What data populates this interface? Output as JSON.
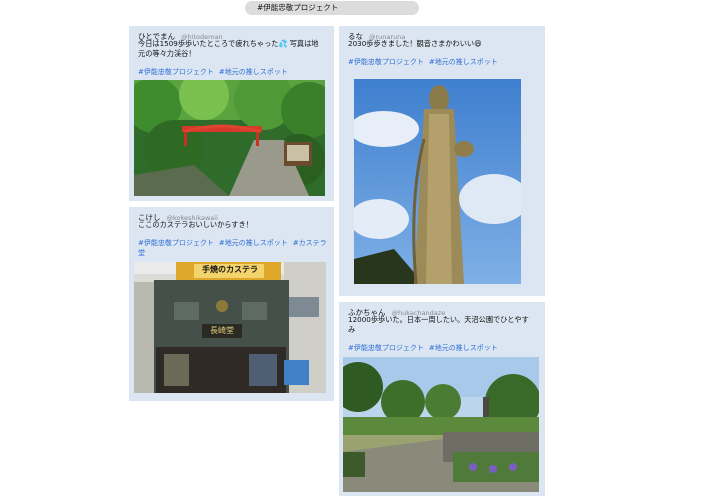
{
  "search_tag": "#伊能忠敬プロジェクト",
  "posts": [
    {
      "name": "ひとでまん",
      "handle": "@hitodeman",
      "message_line1": "今日は1509歩歩いたところで疲れちゃった💦 写真は地",
      "message_line2": "元の等々力渓谷！",
      "tags": [
        "#伊能忠敬プロジェクト",
        "#地元の推しスポット"
      ],
      "image_icon": "gorge-bridge-photo"
    },
    {
      "name": "るな",
      "handle": "@runaruna",
      "message_line1": "2030歩歩きました！観音さまかわいい😄",
      "tags": [
        "#伊能忠敬プロジェクト",
        "#地元の推しスポット"
      ],
      "image_icon": "kannon-statue-photo"
    },
    {
      "name": "こけし",
      "handle": "@kokeshikawaii",
      "message_line1": "ここのカステラおいしいからすき！",
      "tags": [
        "#伊能忠敬プロジェクト",
        "#地元の推しスポット",
        "#カステラ",
        "堂"
      ],
      "image_icon": "castella-shop-photo",
      "shop_sign": "手焼のカステラ",
      "shop_name": "長崎堂"
    },
    {
      "name": "ふかちゃん",
      "handle": "@hukachandaze",
      "message_line1": "12000歩歩いた。日本一周したい。天沼公園でひとやす",
      "message_line2": "み",
      "tags": [
        "#伊能忠敬プロジェクト",
        "#地元の推しスポット"
      ],
      "image_icon": "park-photo"
    }
  ]
}
